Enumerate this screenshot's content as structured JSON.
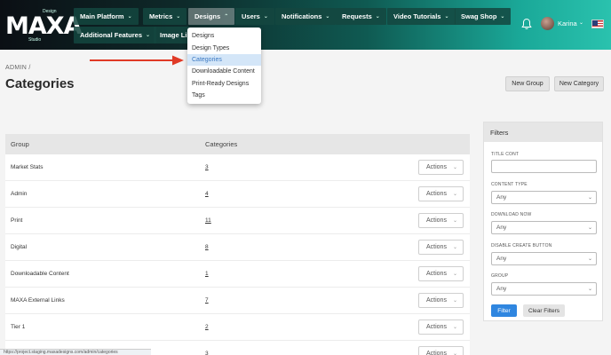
{
  "logo": {
    "text": "MAXA",
    "tiny_top": "Design",
    "tiny_bottom": "Studio"
  },
  "nav": {
    "row1": [
      {
        "label": "Main Platform"
      },
      {
        "label": "Metrics"
      },
      {
        "label": "Designs",
        "open": true
      },
      {
        "label": "Users"
      },
      {
        "label": "Notifications"
      },
      {
        "label": "Requests"
      },
      {
        "label": "Video Tutorials"
      },
      {
        "label": "Swag Shop"
      }
    ],
    "row2": [
      {
        "label": "Additional Features"
      },
      {
        "label": "Image Lib"
      }
    ]
  },
  "user": {
    "name": "Karina"
  },
  "designs_menu": {
    "items": [
      "Designs",
      "Design Types",
      "Categories",
      "Downloadable Content",
      "Print-Ready Designs",
      "Tags"
    ],
    "active_index": 2
  },
  "breadcrumb": {
    "root": "ADMIN",
    "sep": "/"
  },
  "page": {
    "title": "Categories"
  },
  "buttons": {
    "new_group": "New Group",
    "new_category": "New Category"
  },
  "table": {
    "headers": {
      "group": "Group",
      "categories": "Categories"
    },
    "rows": [
      {
        "group": "Market Stats",
        "count": "3"
      },
      {
        "group": "Admin",
        "count": "4"
      },
      {
        "group": "Print",
        "count": "11"
      },
      {
        "group": "Digital",
        "count": "8"
      },
      {
        "group": "Downloadable Content",
        "count": "1"
      },
      {
        "group": "MAXA External Links",
        "count": "7"
      },
      {
        "group": "Tier 1",
        "count": "2"
      },
      {
        "group": "",
        "count": "3"
      }
    ],
    "actions_label": "Actions"
  },
  "filters": {
    "title": "Filters",
    "title_cont_label": "TITLE CONT",
    "title_cont_value": "",
    "content_type_label": "CONTENT TYPE",
    "content_type_value": "Any",
    "download_now_label": "DOWNLOAD NOW",
    "download_now_value": "Any",
    "disable_create_label": "DISABLE CREATE BUTTON",
    "disable_create_value": "Any",
    "group_label": "GROUP",
    "group_value": "Any",
    "filter_button": "Filter",
    "clear_button": "Clear Filters"
  },
  "status_url": "https://project.staging.maxadesigns.com/admin/categories",
  "colors": {
    "primary_button": "#2f86e0",
    "menu_active_bg": "#d4e6f8",
    "menu_active_text": "#3a78c2",
    "arrow": "#e03a26"
  }
}
